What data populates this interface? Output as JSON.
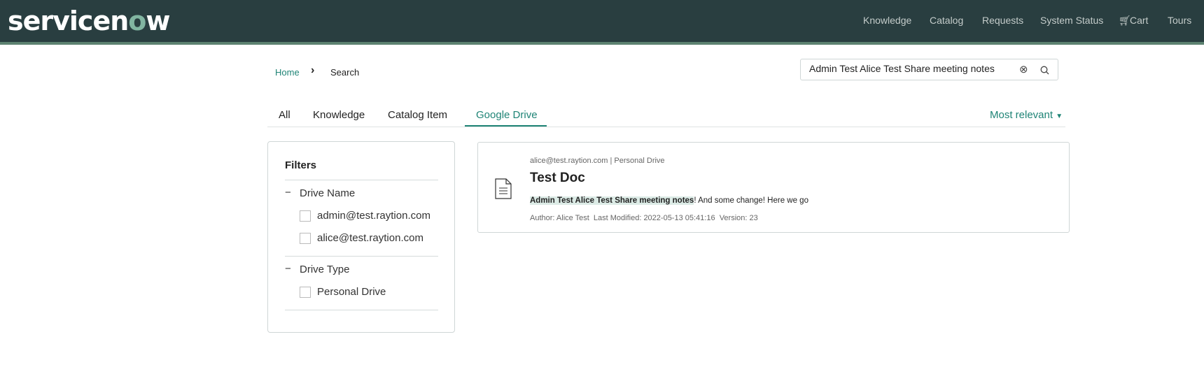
{
  "header": {
    "logo": "servicenow",
    "nav": [
      "Knowledge",
      "Catalog",
      "Requests",
      "System Status",
      "Cart",
      "Tours"
    ]
  },
  "breadcrumb": {
    "home": "Home",
    "current": "Search"
  },
  "search": {
    "value": "Admin Test Alice Test Share meeting notes"
  },
  "tabs": [
    "All",
    "Knowledge",
    "Catalog Item",
    "Google Drive"
  ],
  "active_tab": "Google Drive",
  "sort": {
    "label": "Most relevant"
  },
  "filters": {
    "title": "Filters",
    "groups": [
      {
        "label": "Drive Name",
        "options": [
          "admin@test.raytion.com",
          "alice@test.raytion.com"
        ]
      },
      {
        "label": "Drive Type",
        "options": [
          "Personal Drive"
        ]
      }
    ]
  },
  "result": {
    "source": "alice@test.raytion.com | Personal Drive",
    "title": "Test Doc",
    "highlight": "Admin Test Alice Test Share meeting notes",
    "snippet": "! And some change! Here we go",
    "meta": "Author: Alice Test  Last Modified: 2022-05-13 05:41:16  Version: 23"
  },
  "colors": {
    "header": "#293e40",
    "accent": "#1f8476"
  }
}
